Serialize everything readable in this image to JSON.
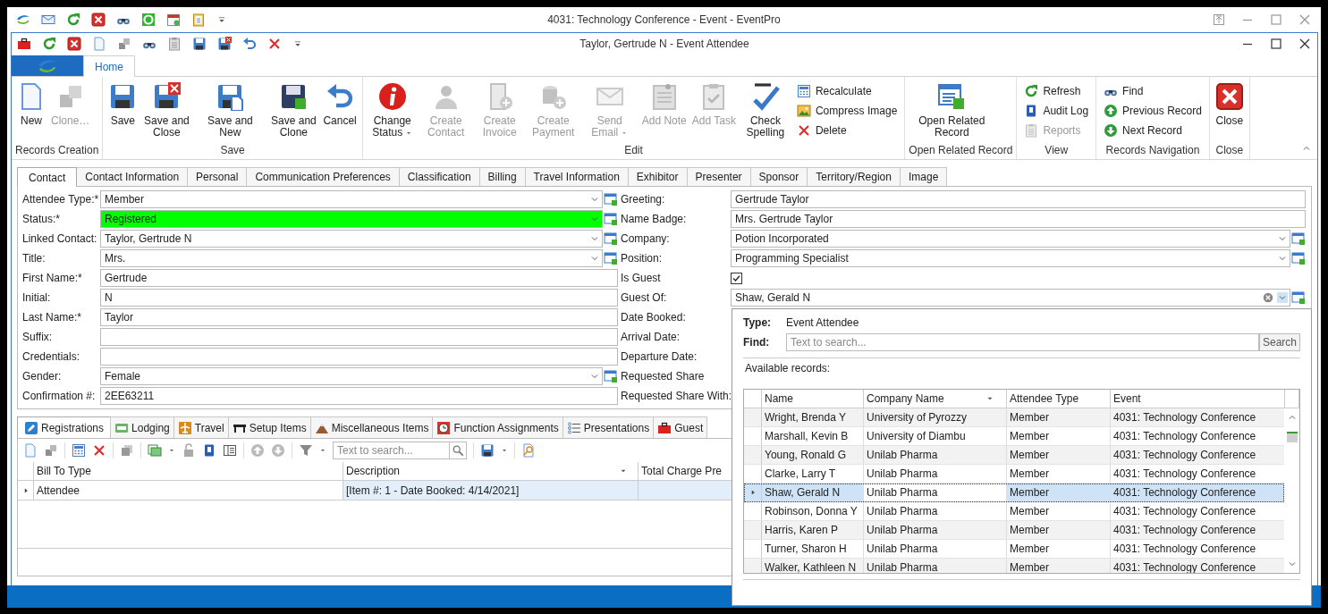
{
  "app_window": {
    "title": "4031: Technology Conference - Event - EventPro"
  },
  "window": {
    "title": "Taylor, Gertrude N - Event Attendee"
  },
  "ribbon": {
    "tabs": [
      {
        "label": "Home",
        "selected": true
      }
    ],
    "groups": [
      {
        "label": "Records Creation",
        "items": [
          {
            "kind": "large",
            "label": "New",
            "disabled": false
          },
          {
            "kind": "large",
            "label": "Clone…",
            "disabled": true
          }
        ]
      },
      {
        "label": "Save",
        "items": [
          {
            "kind": "large",
            "label": "Save",
            "disabled": false
          },
          {
            "kind": "large",
            "label": "Save and Close",
            "disabled": false
          },
          {
            "kind": "large",
            "label": "Save and New",
            "disabled": false
          },
          {
            "kind": "large",
            "label": "Save and Clone",
            "disabled": false
          },
          {
            "kind": "large",
            "label": "Cancel",
            "disabled": false
          }
        ]
      },
      {
        "label": "Edit",
        "items": [
          {
            "kind": "large",
            "label": "Change Status",
            "disabled": false,
            "dropdown": true
          },
          {
            "kind": "large",
            "label": "Create Contact",
            "disabled": true
          },
          {
            "kind": "large",
            "label": "Create Invoice",
            "disabled": true
          },
          {
            "kind": "large",
            "label": "Create Payment",
            "disabled": true
          },
          {
            "kind": "large",
            "label": "Send Email",
            "disabled": true,
            "dropdown": true
          },
          {
            "kind": "large",
            "label": "Add Note",
            "disabled": true
          },
          {
            "kind": "large",
            "label": "Add Task",
            "disabled": true
          },
          {
            "kind": "large",
            "label": "Check Spelling",
            "disabled": false
          },
          {
            "kind": "small",
            "label": "Recalculate",
            "disabled": false
          },
          {
            "kind": "small",
            "label": "Compress Image",
            "disabled": false
          },
          {
            "kind": "small",
            "label": "Delete",
            "disabled": false
          }
        ]
      },
      {
        "label": "Open Related Record",
        "items": [
          {
            "kind": "large",
            "label": "Open Related Record",
            "disabled": false
          }
        ]
      },
      {
        "label": "View",
        "items": [
          {
            "kind": "small",
            "label": "Refresh",
            "disabled": false
          },
          {
            "kind": "small",
            "label": "Audit Log",
            "disabled": false
          },
          {
            "kind": "small",
            "label": "Reports",
            "disabled": true
          }
        ]
      },
      {
        "label": "Records Navigation",
        "items": [
          {
            "kind": "small",
            "label": "Find",
            "disabled": false
          },
          {
            "kind": "small",
            "label": "Previous Record",
            "disabled": false
          },
          {
            "kind": "small",
            "label": "Next Record",
            "disabled": false
          }
        ]
      },
      {
        "label": "Close",
        "items": [
          {
            "kind": "large",
            "label": "Close",
            "disabled": false
          }
        ]
      }
    ]
  },
  "form_tabs": [
    {
      "label": "Contact",
      "selected": true
    },
    {
      "label": "Contact Information",
      "selected": false
    },
    {
      "label": "Personal",
      "selected": false
    },
    {
      "label": "Communication Preferences",
      "selected": false
    },
    {
      "label": "Classification",
      "selected": false
    },
    {
      "label": "Billing",
      "selected": false
    },
    {
      "label": "Travel Information",
      "selected": false
    },
    {
      "label": "Exhibitor",
      "selected": false
    },
    {
      "label": "Presenter",
      "selected": false
    },
    {
      "label": "Sponsor",
      "selected": false
    },
    {
      "label": "Territory/Region",
      "selected": false
    },
    {
      "label": "Image",
      "selected": false
    }
  ],
  "left_fields": [
    {
      "label": "Attendee Type:*",
      "kind": "combo",
      "value": "Member"
    },
    {
      "label": "Status:*",
      "kind": "combo",
      "value": "Registered",
      "color": "#00ff00"
    },
    {
      "label": "Linked Contact:",
      "kind": "combo",
      "value": "Taylor, Gertrude N"
    },
    {
      "label": "Title:",
      "kind": "combo",
      "value": "Mrs."
    },
    {
      "label": "First Name:*",
      "kind": "text",
      "value": "Gertrude"
    },
    {
      "label": "Initial:",
      "kind": "text",
      "value": "N"
    },
    {
      "label": "Last Name:*",
      "kind": "text",
      "value": "Taylor"
    },
    {
      "label": "Suffix:",
      "kind": "text"
    },
    {
      "label": "Credentials:",
      "kind": "text"
    },
    {
      "label": "Gender:",
      "kind": "combo",
      "value": "Female"
    },
    {
      "label": "Confirmation #:",
      "kind": "text",
      "value": "2EE63211"
    }
  ],
  "right_fields": [
    {
      "label": "Greeting:",
      "kind": "text",
      "value": "Gertrude Taylor"
    },
    {
      "label": "Name Badge:",
      "kind": "text",
      "value": "Mrs. Gertrude Taylor"
    },
    {
      "label": "Company:",
      "kind": "combo",
      "value": "Potion Incorporated"
    },
    {
      "label": "Position:",
      "kind": "combo",
      "value": "Programming Specialist"
    },
    {
      "label": "Is Guest",
      "kind": "checkbox",
      "checked": true
    },
    {
      "label": "Guest Of:",
      "kind": "combo",
      "value": "Shaw, Gerald N",
      "clearable": true
    },
    {
      "label": "Date Booked:",
      "kind": "covered"
    },
    {
      "label": "Arrival Date:",
      "kind": "covered"
    },
    {
      "label": "Departure Date:",
      "kind": "covered"
    },
    {
      "label": "Requested Share",
      "kind": "covered"
    },
    {
      "label": "Requested Share With:",
      "kind": "covered"
    }
  ],
  "detail_tabs": [
    {
      "label": "Registrations",
      "selected": true
    },
    {
      "label": "Lodging",
      "selected": false
    },
    {
      "label": "Travel",
      "selected": false
    },
    {
      "label": "Setup Items",
      "selected": false
    },
    {
      "label": "Miscellaneous Items",
      "selected": false
    },
    {
      "label": "Function Assignments",
      "selected": false
    },
    {
      "label": "Presentations",
      "selected": false
    },
    {
      "label": "Guest",
      "selected": false
    }
  ],
  "detail_search": {
    "placeholder": "Text to search..."
  },
  "detail_grid": {
    "columns": [
      "Bill To Type",
      "Description",
      "Total Charge Pre"
    ],
    "rows": [
      {
        "cells": [
          "Attendee",
          "[Item #: 1 - Date Booked: 4/14/2021]"
        ],
        "selected": true
      }
    ]
  },
  "lookup": {
    "type_label": "Type:",
    "type_value": "Event Attendee",
    "find_label": "Find:",
    "find_placeholder": "Text to search...",
    "search_button": "Search",
    "records_label": "Available records:",
    "columns": [
      "Name",
      "Company Name",
      "Attendee Type",
      "Event"
    ],
    "rows": [
      {
        "cells": [
          "Wright, Brenda Y",
          "University of Pyrozzy",
          "Member",
          "4031: Technology Conference"
        ],
        "selected": false
      },
      {
        "cells": [
          "Marshall, Kevin B",
          "University of Diambu",
          "Member",
          "4031: Technology Conference"
        ],
        "selected": false
      },
      {
        "cells": [
          "Young, Ronald G",
          "Unilab Pharma",
          "Member",
          "4031: Technology Conference"
        ],
        "selected": false
      },
      {
        "cells": [
          "Clarke, Larry T",
          "Unilab Pharma",
          "Member",
          "4031: Technology Conference"
        ],
        "selected": false
      },
      {
        "cells": [
          "Shaw, Gerald N",
          "Unilab Pharma",
          "Member",
          "4031: Technology Conference"
        ],
        "selected": true
      },
      {
        "cells": [
          "Robinson, Donna Y",
          "Unilab Pharma",
          "Member",
          "4031: Technology Conference"
        ],
        "selected": false
      },
      {
        "cells": [
          "Harris, Karen P",
          "Unilab Pharma",
          "Member",
          "4031: Technology Conference"
        ],
        "selected": false
      },
      {
        "cells": [
          "Turner, Sharon H",
          "Unilab Pharma",
          "Member",
          "4031: Technology Conference"
        ],
        "selected": false
      },
      {
        "cells": [
          "Walker, Kathleen N",
          "Unilab Pharma",
          "Member",
          "4031: Technology Conference"
        ],
        "selected": false
      }
    ]
  }
}
